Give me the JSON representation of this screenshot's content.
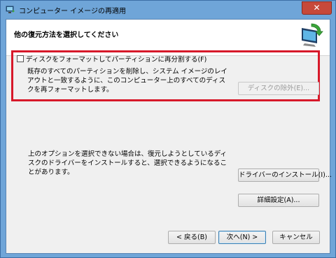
{
  "window": {
    "title": "コンピューター イメージの再適用",
    "close_label": "✕"
  },
  "header": {
    "title": "他の復元方法を選択してください"
  },
  "format_option": {
    "checkbox_label": "ディスクをフォーマットしてパーティションに再分割する(F)",
    "checked": false,
    "description": "既存のすべてのパーティションを削除し、システム イメージのレイアウトと一致するように、このコンピューター上のすべてのディスクを再フォーマットします。",
    "exclude_button": "ディスクの除外(E)..."
  },
  "driver_option": {
    "description": "上のオプションを選択できない場合は、復元しようとしているディスクのドライバーをインストールすると、選択できるようになることがあります。",
    "install_button": "ドライバーのインストール(I)...",
    "advanced_button": "詳細設定(A)..."
  },
  "footer": {
    "back_button": "< 戻る(B)",
    "next_button": "次へ(N) >",
    "cancel_button": "キャンセル"
  },
  "colors": {
    "highlight": "#d7192a",
    "titlebar": "#6fa5d8",
    "close": "#c7493a"
  }
}
